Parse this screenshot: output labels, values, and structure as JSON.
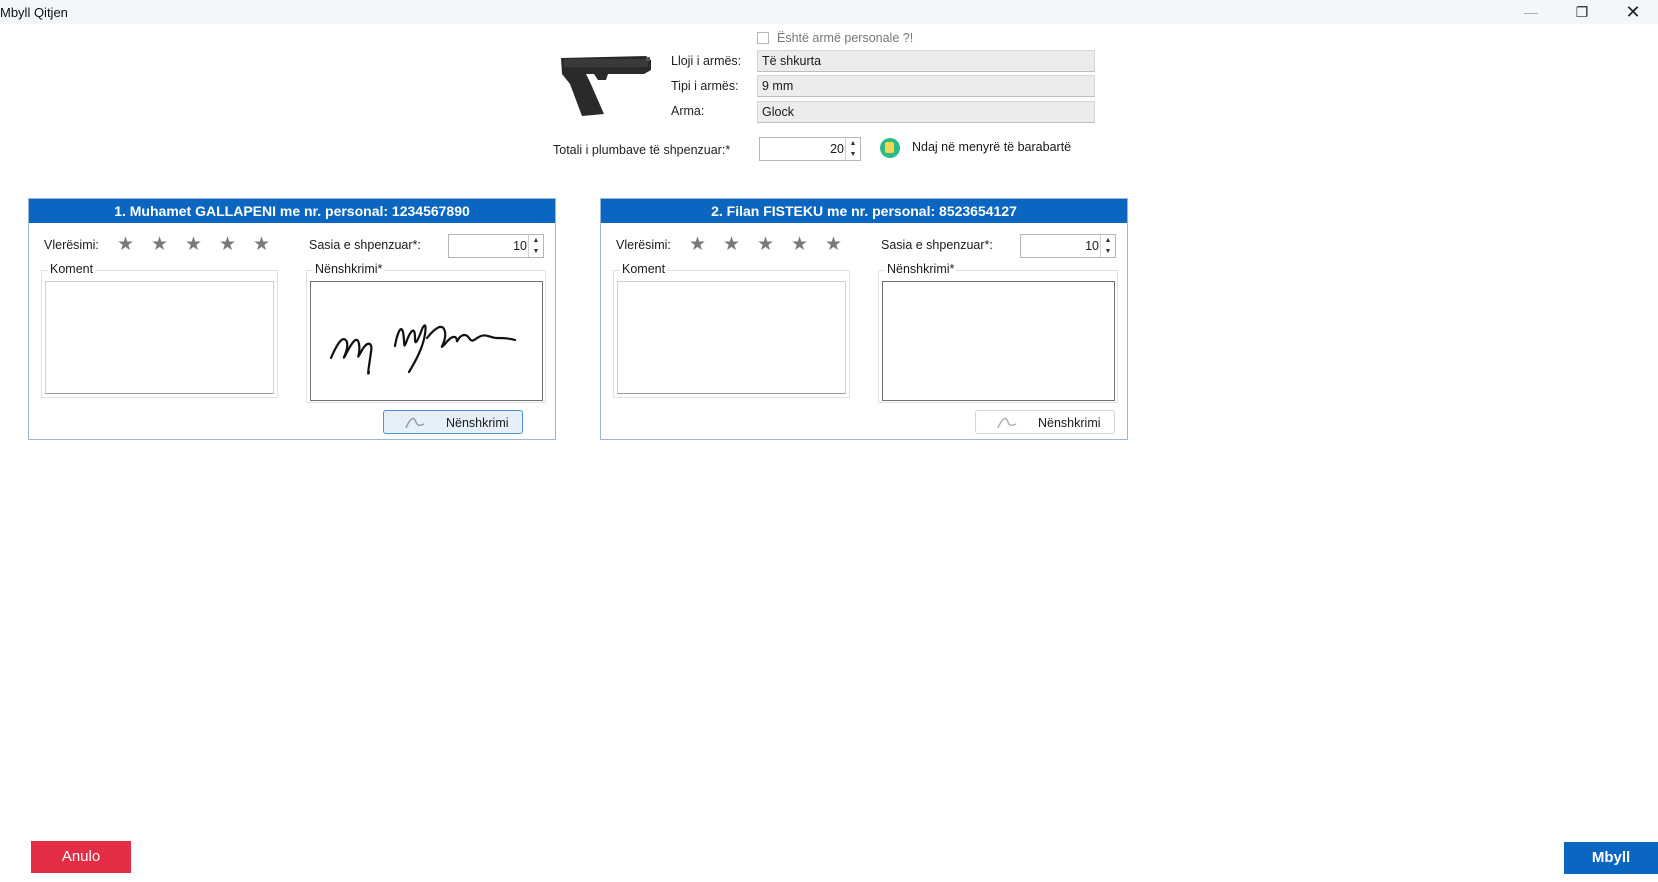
{
  "window": {
    "title": "Mbyll Qitjen",
    "minimize_glyph": "—",
    "maximize_glyph": "❐",
    "close_glyph": "✕"
  },
  "weapon": {
    "personal_checkbox_label": "Është armë personale ?!",
    "personal_checked": false,
    "image_icon": "pistol-image",
    "type_label": "Lloji i armës:",
    "type_value": "Të shkurta",
    "caliber_label": "Tipi i armës:",
    "caliber_value": "9 mm",
    "weapon_label": "Arma:",
    "weapon_value": "Glock"
  },
  "total": {
    "label": "Totali i plumbave të shpenzuar:*",
    "value": "20",
    "distribute_label": "Ndaj në menyrë të barabartë",
    "distribute_icon": "distribute-edit-icon"
  },
  "participants": [
    {
      "header": "1. Muhamet GALLAPENI me nr. personal: 1234567890",
      "rating_label": "Vlerësimi:",
      "rating": 0,
      "stars": [
        "★",
        "★",
        "★",
        "★",
        "★"
      ],
      "quantity_label": "Sasia e shpenzuar*:",
      "quantity": "10",
      "comment_label": "Koment",
      "comment": "",
      "signature_label": "Nënshkrimi*",
      "signed": true,
      "sign_button_label": "Nënshkrimi"
    },
    {
      "header": "2. Filan FISTEKU me nr. personal: 8523654127",
      "rating_label": "Vlerësimi:",
      "rating": 0,
      "stars": [
        "★",
        "★",
        "★",
        "★",
        "★"
      ],
      "quantity_label": "Sasia e shpenzuar*:",
      "quantity": "10",
      "comment_label": "Koment",
      "comment": "",
      "signature_label": "Nënshkrimi*",
      "signed": false,
      "sign_button_label": "Nënshkrimi"
    }
  ],
  "footer": {
    "cancel_label": "Anulo",
    "close_label": "Mbyll"
  },
  "colors": {
    "accent": "#0b66c1",
    "cancel": "#e22d45"
  }
}
